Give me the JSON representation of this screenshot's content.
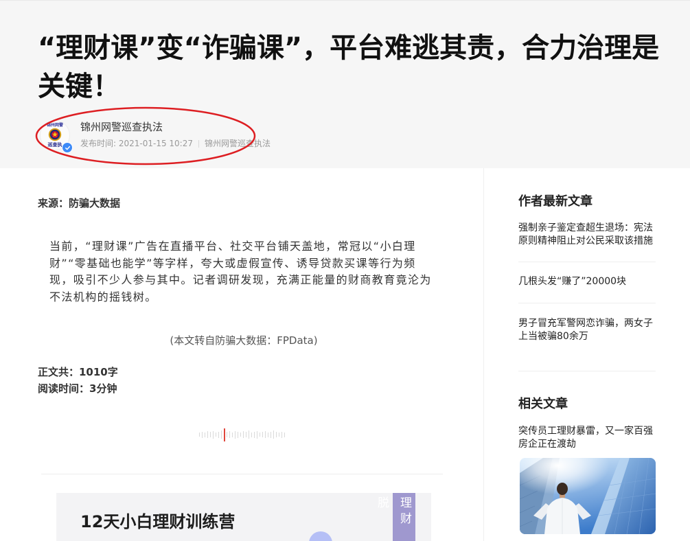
{
  "article": {
    "title": "“理财课”变“诈骗课”，平台难逃其责，合力治理是关键！",
    "author": {
      "name": "锦州网警巡查执法",
      "avatar_logo_top": "锦州网警",
      "avatar_logo_bottom": "巡查执",
      "publish_time": "发布时间: 2021-01-15 10:27",
      "publish_source": "锦州网警巡查执法"
    },
    "source_line": "来源：防骗大数据",
    "paragraph": "当前，“理财课”广告在直播平台、社交平台铺天盖地，常冠以“小白理财”“零基础也能学”等字样，夸大或虚假宣传、诱导贷款买课等行为频现，吸引不少人参与其中。记者调研发现，充满正能量的财商教育竟沦为不法机构的摇钱树。",
    "reprint_note": "(本文转自防骗大数据：FPData)",
    "word_count": "正文共：1010字",
    "read_time": "阅读时间：3分钟",
    "promo_image": {
      "headline": "12天小白理财训练营",
      "side_label": "理财脱"
    }
  },
  "sidebar": {
    "latest_title": "作者最新文章",
    "latest_items": [
      {
        "title": "强制亲子鉴定查超生退场：宪法原则精神阻止对公民采取该措施"
      },
      {
        "title": "几根头发“赚了”20000块"
      },
      {
        "title": "男子冒充军警网恋诈骗，两女子上当被骗80余万"
      }
    ],
    "related_title": "相关文章",
    "related_items": [
      {
        "title": "突传员工理财暴雷，又一家百强房企正在渡劫"
      }
    ]
  },
  "icons": {
    "verified": "verified-check-icon",
    "emblem": "police-emblem-icon"
  },
  "colors": {
    "header_bg": "#f6f6f6",
    "annotation_red": "#dd1e22",
    "verified_blue": "#3d8af7",
    "waveform_active": "#e0463c",
    "promo_strip": "#9f98cf"
  }
}
